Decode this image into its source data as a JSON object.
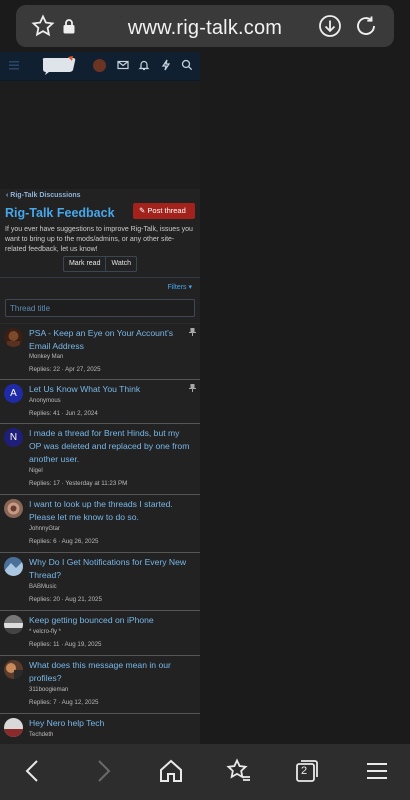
{
  "browser": {
    "url": "www.rig-talk.com"
  },
  "breadcrumb": {
    "label": "Rig-Talk Discussions"
  },
  "forum": {
    "title": "Rig-Talk Feedback",
    "post_thread_label": "Post thread",
    "description": "If you ever have suggestions to improve Rig-Talk, issues you want to bring up to the mods/admins, or any other site-related feedback, let us know!",
    "mark_read_label": "Mark read",
    "watch_label": "Watch",
    "filters_label": "Filters",
    "search_placeholder": "Thread title"
  },
  "threads": [
    {
      "title": "PSA - Keep an Eye on Your Account's Email Address",
      "author": "Monkey Man",
      "meta": "Replies: 22 · Apr 27, 2025",
      "avatar": ""
    },
    {
      "title": "Let Us Know What You Think",
      "author": "Anonymous",
      "meta": "Replies: 41 · Jun 2, 2024",
      "avatar": "A"
    },
    {
      "title": "I made a thread for Brent Hinds, but my OP was deleted and replaced by one from another user.",
      "author": "Nigel",
      "meta": "Replies: 17 · Yesterday at 11:23 PM",
      "avatar": "N"
    },
    {
      "title": "I want to look up the threads I started. Please let me know to do so.",
      "author": "JohnnyGtar",
      "meta": "Replies: 6 · Aug 26, 2025",
      "avatar": ""
    },
    {
      "title": "Why Do I Get Notifications for Every New Thread?",
      "author": "BABMusic",
      "meta": "Replies: 20 · Aug 21, 2025",
      "avatar": ""
    },
    {
      "title": "Keep getting bounced on iPhone",
      "author": "* velcro-fly *",
      "meta": "Replies: 11 · Aug 19, 2025",
      "avatar": ""
    },
    {
      "title": "What does this message mean in our profiles?",
      "author": "311boogieman",
      "meta": "Replies: 7 · Aug 12, 2025",
      "avatar": ""
    },
    {
      "title": "Hey Nero help Tech",
      "author": "Techdeth",
      "meta": "",
      "avatar": ""
    }
  ],
  "tab_count": "2",
  "colors": {
    "link": "#47a7eb",
    "post_button": "#a3231c",
    "nav_bg": "#102031"
  }
}
